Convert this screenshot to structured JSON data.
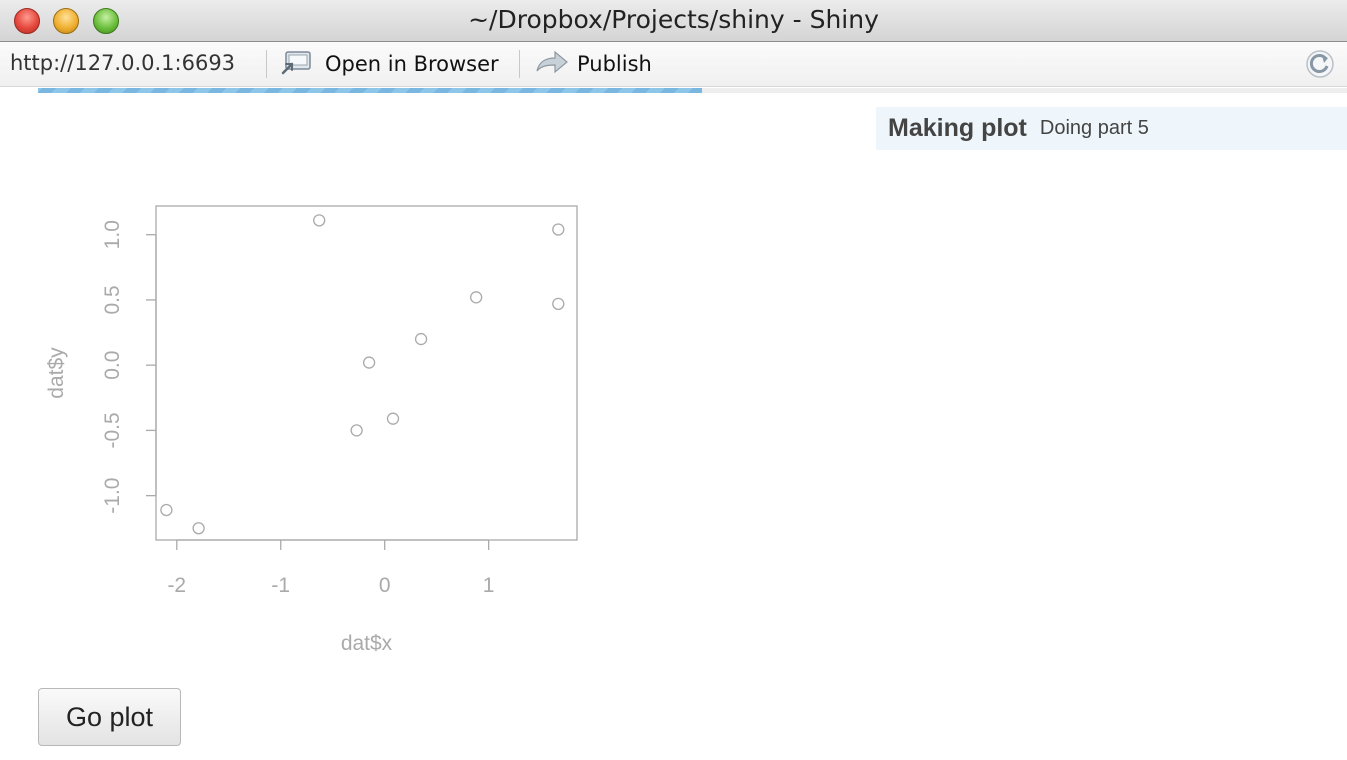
{
  "window": {
    "title": "~/Dropbox/Projects/shiny - Shiny"
  },
  "toolbar": {
    "url": "http://127.0.0.1:6693",
    "open_in_browser_label": "Open in Browser",
    "publish_label": "Publish"
  },
  "progress": {
    "fraction": 0.507,
    "color": "#7ab7e0"
  },
  "status": {
    "title": "Making plot",
    "detail": "Doing part 5"
  },
  "chart_data": {
    "type": "scatter",
    "xlabel": "dat$x",
    "ylabel": "dat$y",
    "xlim": [
      -2.2,
      1.85
    ],
    "ylim": [
      -1.34,
      1.22
    ],
    "x_ticks": [
      -2,
      -1,
      0,
      1
    ],
    "x_tick_labels": [
      "-2",
      "-1",
      "0",
      "1"
    ],
    "y_ticks": [
      -1.0,
      -0.5,
      0.0,
      0.5,
      1.0
    ],
    "y_tick_labels": [
      "-1.0",
      "-0.5",
      "0.0",
      "0.5",
      "1.0"
    ],
    "points": [
      {
        "x": -2.1,
        "y": -1.11
      },
      {
        "x": -1.79,
        "y": -1.25
      },
      {
        "x": -0.63,
        "y": 1.11
      },
      {
        "x": -0.27,
        "y": -0.5
      },
      {
        "x": -0.15,
        "y": 0.02
      },
      {
        "x": 0.08,
        "y": -0.41
      },
      {
        "x": 0.35,
        "y": 0.2
      },
      {
        "x": 0.88,
        "y": 0.52
      },
      {
        "x": 1.67,
        "y": 1.04
      },
      {
        "x": 1.67,
        "y": 0.47
      }
    ],
    "grid": false,
    "color": "#aaaaaa"
  },
  "go_button": {
    "label": "Go plot"
  }
}
